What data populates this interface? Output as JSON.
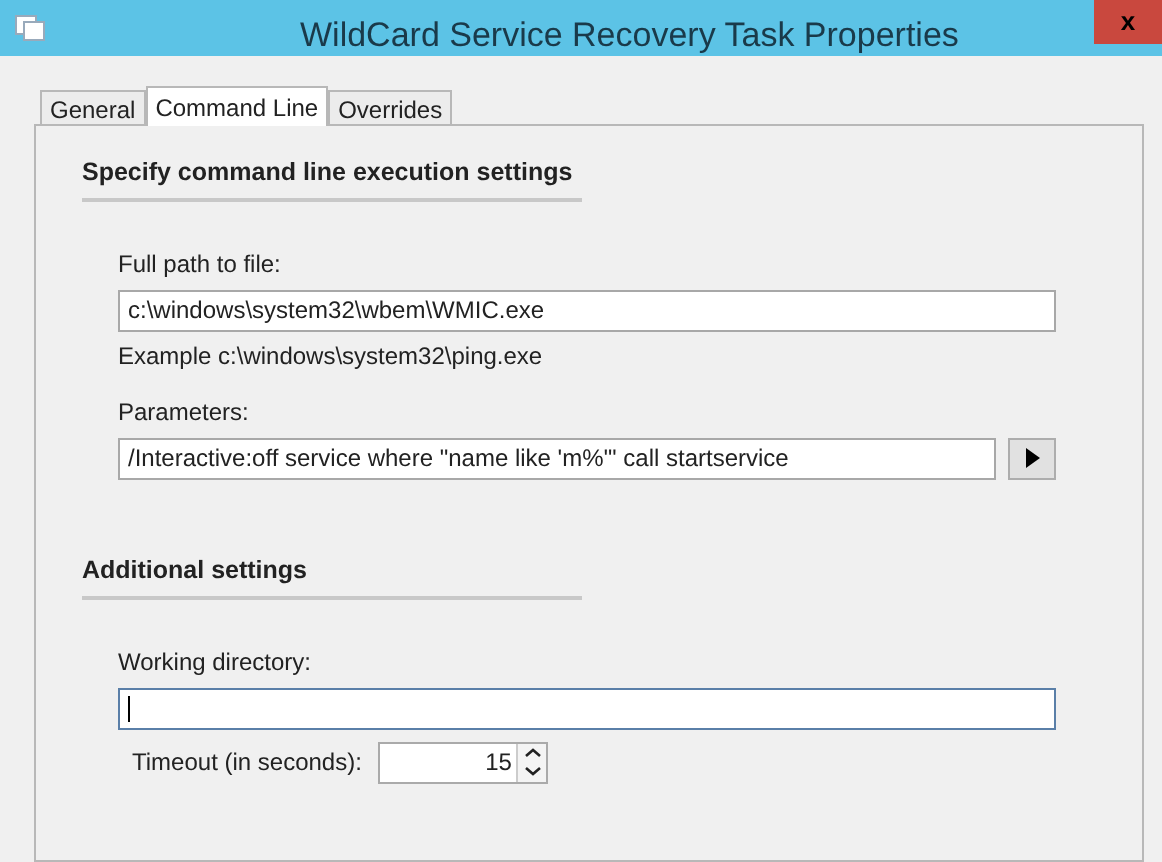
{
  "window": {
    "title": "WildCard Service Recovery Task Properties",
    "close": "x"
  },
  "tabs": [
    {
      "label": "General",
      "selected": false
    },
    {
      "label": "Command Line",
      "selected": true
    },
    {
      "label": "Overrides",
      "selected": false
    }
  ],
  "sections": [
    {
      "heading": "Specify command line execution settings",
      "fields": [
        {
          "kind": "text",
          "label": "Full path to file:",
          "value": "c:\\windows\\system32\\wbem\\WMIC.exe",
          "hint": "Example c:\\windows\\system32\\ping.exe"
        },
        {
          "kind": "text_button",
          "label": "Parameters:",
          "value": "/Interactive:off service where \"name like 'm%'\" call startservice"
        }
      ]
    },
    {
      "heading": "Additional settings",
      "fields": [
        {
          "kind": "text",
          "label": "Working directory:",
          "focused": true
        },
        {
          "kind": "spinner",
          "label": "Timeout (in seconds):",
          "value": "15"
        }
      ]
    }
  ]
}
